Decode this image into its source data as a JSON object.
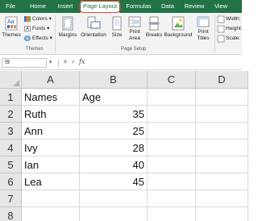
{
  "ribbon_tabs": {
    "file": "File",
    "home": "Home",
    "insert": "Insert",
    "page_layout": "Page Layout",
    "formulas": "Formulas",
    "data": "Data",
    "review": "Review",
    "view": "View"
  },
  "ribbon": {
    "themes": "Themes",
    "colors": "Colors",
    "fonts": "Fonts",
    "effects": "Effects",
    "margins": "Margins",
    "orientation": "Orientation",
    "size": "Size",
    "print_area": "Print Area",
    "breaks": "Breaks",
    "background": "Background",
    "print_titles": "Print Titles",
    "width": "Width:",
    "height": "Height:",
    "scale": "Scale:",
    "group_themes": "Themes",
    "group_page_setup": "Page Setup"
  },
  "formula_bar": {
    "name_box": "I9",
    "fx": "fx"
  },
  "columns": [
    "A",
    "B",
    "C",
    "D"
  ],
  "rows": [
    "1",
    "2",
    "3",
    "4",
    "5",
    "6",
    "7",
    "8"
  ],
  "table": {
    "header": [
      "Names",
      "Age"
    ],
    "data": [
      [
        "Ruth",
        "35"
      ],
      [
        "Ann",
        "25"
      ],
      [
        "Ivy",
        "28"
      ],
      [
        "Ian",
        "40"
      ],
      [
        "Lea",
        "45"
      ]
    ]
  },
  "colors": {
    "accent": "#217346",
    "highlight": "#e0453a"
  }
}
